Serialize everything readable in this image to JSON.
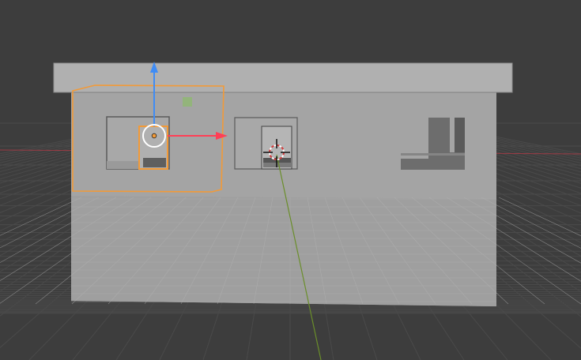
{
  "viewport": {
    "view": "3D Viewport",
    "colors": {
      "background": "#3d3d3d",
      "grid_line": "#4a4a4a",
      "axis_x": "#9b3b45",
      "axis_y": "#6a8e2a",
      "axis_z": "#3b7bd9",
      "wall": "#a4a4a4",
      "roof": "#b0b0b0",
      "selection_outline": "#f29a38",
      "origin": "#f29a38",
      "gizmo_x": "#ff3f56",
      "gizmo_z": "#3f8cf5",
      "light_marker": "#8bbb6a"
    }
  },
  "scene_objects": [
    {
      "name": "house-wall",
      "selected": false
    },
    {
      "name": "roof",
      "selected": false
    },
    {
      "name": "window-left",
      "selected": false
    },
    {
      "name": "door-left",
      "selected": true
    },
    {
      "name": "window-center",
      "selected": false
    },
    {
      "name": "door-center",
      "selected": false
    },
    {
      "name": "window-right-cutout",
      "selected": false
    }
  ],
  "gizmo": {
    "type": "translate",
    "axes": [
      "x",
      "z"
    ]
  },
  "cursor_3d": {
    "visible": true
  }
}
